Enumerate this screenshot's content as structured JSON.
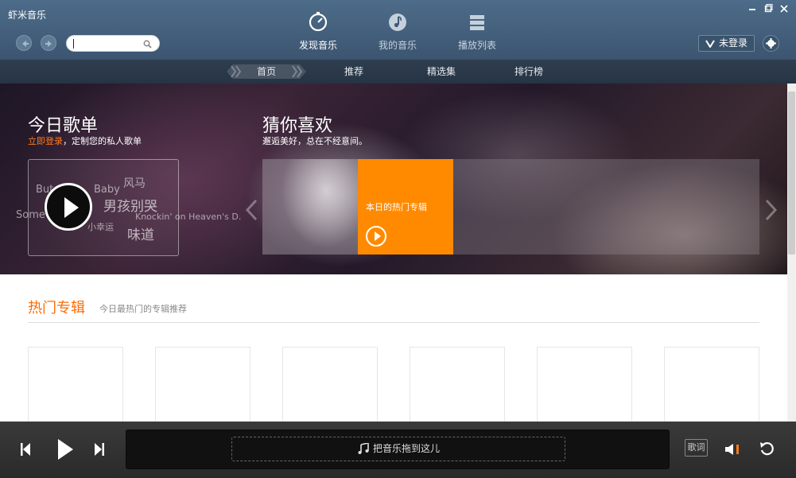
{
  "app": {
    "title": "虾米音乐"
  },
  "search": {
    "value": "",
    "placeholder": ""
  },
  "nav": {
    "tabs": [
      {
        "label": "发现音乐",
        "icon": "compass-icon",
        "active": true
      },
      {
        "label": "我的音乐",
        "icon": "music-note-icon",
        "active": false
      },
      {
        "label": "播放列表",
        "icon": "playlist-icon",
        "active": false
      }
    ]
  },
  "account": {
    "login_label": "未登录"
  },
  "subnav": {
    "items": [
      "首页",
      "推荐",
      "精选集",
      "排行榜"
    ],
    "active_index": 0
  },
  "banner": {
    "daily": {
      "title": "今日歌单",
      "login_link": "立即登录",
      "subtitle_rest": "，定制您的私人歌单",
      "words": [
        "But",
        "Baby",
        "风马",
        "男孩别哭",
        "Some",
        "小幸运",
        "Knockin' on Heaven's D.",
        "味道"
      ]
    },
    "guess": {
      "title": "猜你喜欢",
      "subtitle": "邂逅美好，总在不经意间。",
      "highlight_label": "本日的热门专辑"
    }
  },
  "hot_albums": {
    "title": "热门专辑",
    "subtitle": "今日最热门的专辑推荐",
    "count": 6
  },
  "player": {
    "drop_hint": "把音乐拖到这儿",
    "lyrics_label": "歌词"
  },
  "colors": {
    "accent_orange": "#ff8a00",
    "header_blue": "#45617e",
    "player_dark": "#2f2f2f"
  }
}
